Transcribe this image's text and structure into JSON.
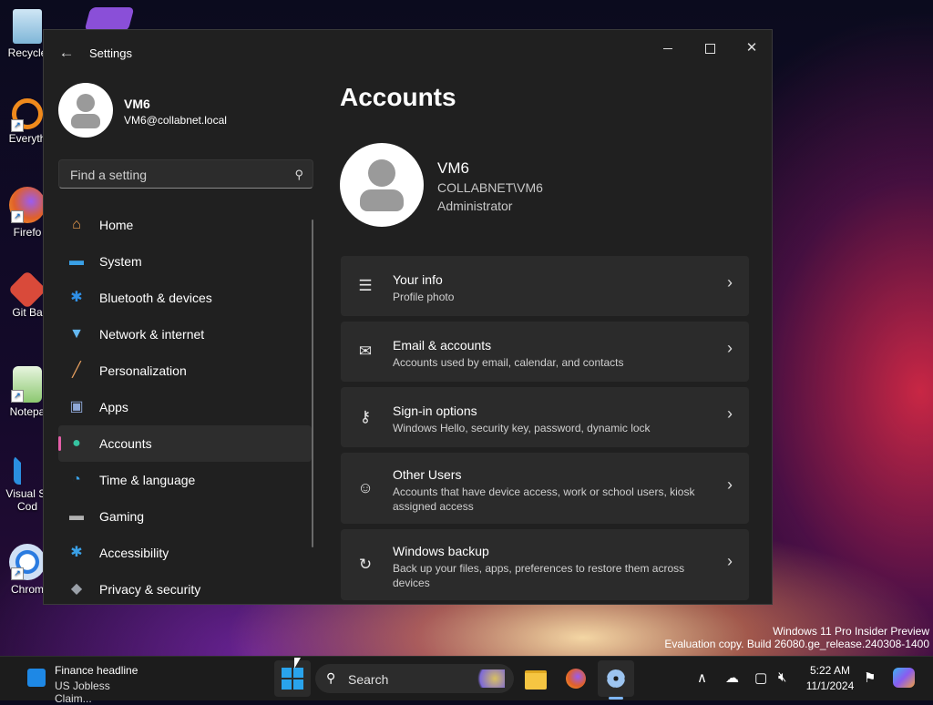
{
  "desktop": {
    "icons": [
      {
        "label": "Recycle",
        "icon": "recycle-bin-icon"
      },
      {
        "label": "Everyth",
        "icon": "everything-search-icon"
      },
      {
        "label": "Firefo",
        "icon": "firefox-icon"
      },
      {
        "label": "Git Ba",
        "icon": "git-bash-icon"
      },
      {
        "label": "Notepa",
        "icon": "notepad-icon"
      },
      {
        "label": "Visual St",
        "label2": "Cod",
        "icon": "vscode-icon"
      },
      {
        "label": "Chrom",
        "icon": "chrome-icon"
      }
    ]
  },
  "window": {
    "title": "Settings",
    "back_icon": "←",
    "close_glyph": "✕"
  },
  "profile": {
    "name": "VM6",
    "email": "VM6@collabnet.local"
  },
  "search": {
    "placeholder": "Find a setting",
    "icon": "⚲"
  },
  "nav": {
    "items": [
      {
        "label": "Home",
        "icon": "home-icon",
        "glyph": "⌂",
        "color": "#f0a050"
      },
      {
        "label": "System",
        "icon": "system-icon",
        "glyph": "▬",
        "color": "#3aa0e6"
      },
      {
        "label": "Bluetooth & devices",
        "icon": "bluetooth-icon",
        "glyph": "✱",
        "color": "#2f8fe6"
      },
      {
        "label": "Network & internet",
        "icon": "network-icon",
        "glyph": "▼",
        "color": "#64b8f0"
      },
      {
        "label": "Personalization",
        "icon": "brush-icon",
        "glyph": "╱",
        "color": "#e8a060"
      },
      {
        "label": "Apps",
        "icon": "apps-icon",
        "glyph": "▣",
        "color": "#8fa8d8"
      },
      {
        "label": "Accounts",
        "icon": "accounts-icon",
        "glyph": "●",
        "color": "#36c3a0",
        "active": true
      },
      {
        "label": "Time & language",
        "icon": "time-language-icon",
        "glyph": "◔",
        "color": "#3aa0e6"
      },
      {
        "label": "Gaming",
        "icon": "gaming-icon",
        "glyph": "▬",
        "color": "#b0b0b0"
      },
      {
        "label": "Accessibility",
        "icon": "accessibility-icon",
        "glyph": "✱",
        "color": "#3aa0e6"
      },
      {
        "label": "Privacy & security",
        "icon": "shield-icon",
        "glyph": "◆",
        "color": "#9aa0a8"
      }
    ]
  },
  "main": {
    "title": "Accounts",
    "account": {
      "name": "VM6",
      "domain": "COLLABNET\\VM6",
      "role": "Administrator"
    },
    "cards": [
      {
        "title": "Your info",
        "subtitle": "Profile photo",
        "icon": "person-info-icon",
        "glyph": "☰"
      },
      {
        "title": "Email & accounts",
        "subtitle": "Accounts used by email, calendar, and contacts",
        "icon": "mail-icon",
        "glyph": "✉"
      },
      {
        "title": "Sign-in options",
        "subtitle": "Windows Hello, security key, password, dynamic lock",
        "icon": "key-icon",
        "glyph": "⚷"
      },
      {
        "title": "Other Users",
        "subtitle": "Accounts that have device access, work or school users, kiosk assigned access",
        "icon": "add-user-icon",
        "glyph": "☺"
      },
      {
        "title": "Windows backup",
        "subtitle": "Back up your files, apps, preferences to restore them across devices",
        "icon": "backup-icon",
        "glyph": "↻"
      }
    ],
    "chevron": "›"
  },
  "watermark": {
    "line1": "Windows 11 Pro Insider Preview",
    "line2": "Evaluation copy. Build 26080.ge_release.240308-1400"
  },
  "taskbar": {
    "widget_title": "Finance headline",
    "widget_text": "US Jobless Claim...",
    "search_label": "Search",
    "time": "5:22 AM",
    "date": "11/1/2024",
    "tray_glyph_chevron": "∧",
    "tray_glyph_bell": "⚑"
  }
}
